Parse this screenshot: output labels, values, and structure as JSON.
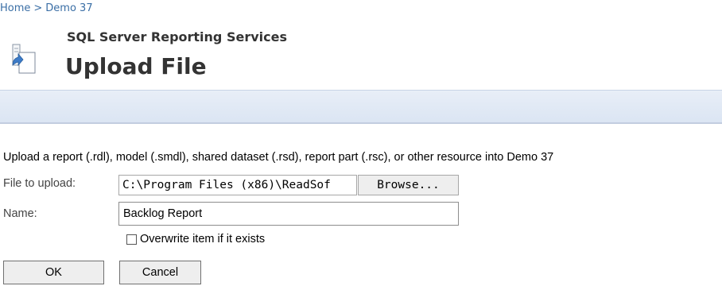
{
  "breadcrumb": {
    "home": "Home",
    "separator": ">",
    "current": "Demo 37"
  },
  "header": {
    "app_name": "SQL Server Reporting Services",
    "page_title": "Upload File",
    "icon": "upload-document-icon"
  },
  "form": {
    "instructions": "Upload a report (.rdl), model (.smdl), shared dataset (.rsd), report part (.rsc), or other resource into Demo 37",
    "file_label": "File to upload:",
    "file_path": "C:\\Program Files (x86)\\ReadSof",
    "browse_label": "Browse...",
    "name_label": "Name:",
    "name_value": "Backlog Report",
    "overwrite_checked": false,
    "overwrite_label": "Overwrite item if it exists"
  },
  "actions": {
    "ok_label": "OK",
    "cancel_label": "Cancel"
  },
  "colors": {
    "link": "#3a6ea5",
    "band": "#dbe5f3",
    "title": "#333333"
  }
}
